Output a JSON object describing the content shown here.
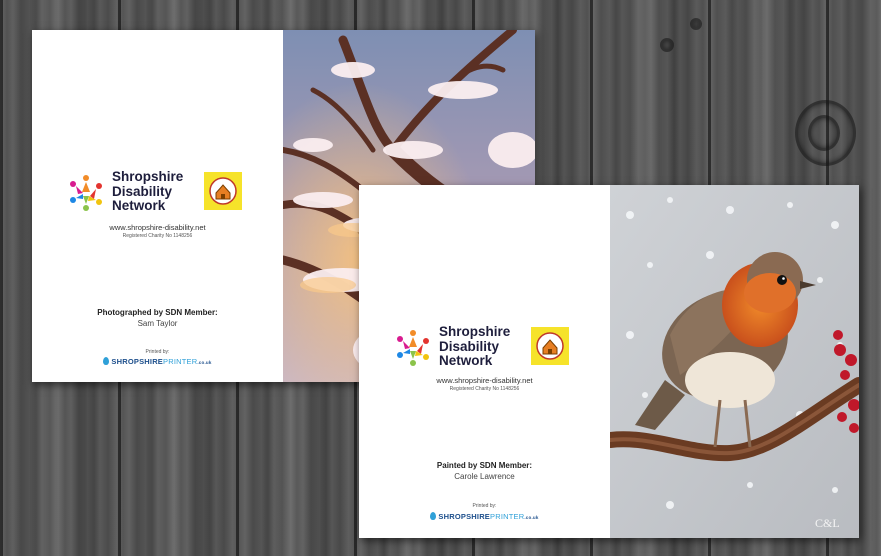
{
  "organization": {
    "name_lines": [
      "Shropshire",
      "Disability",
      "Network"
    ],
    "website": "www.shropshire-disability.net",
    "charity": "Registered Charity No 1148256"
  },
  "cards": [
    {
      "credit": "Photographed by SDN Member:",
      "member": "Sam Taylor",
      "printed_by": "Printed by:",
      "printer_bold": "SHROPSHIRE",
      "printer_light": "PRINTER",
      "printer_tld": ".co.uk",
      "image": "snowy-tree-branches-photo"
    },
    {
      "credit": "Painted by SDN Member:",
      "member": "Carole Lawrence",
      "printed_by": "Printed by:",
      "printer_bold": "SHROPSHIRE",
      "printer_light": "PRINTER",
      "printer_tld": ".co.uk",
      "image": "robin-on-branch-painting",
      "signature": "C&L"
    }
  ],
  "colors": {
    "badge_yellow": "#f6e32a",
    "logo_navy": "#1e1e3c",
    "printer_blue": "#1d4f8c"
  }
}
